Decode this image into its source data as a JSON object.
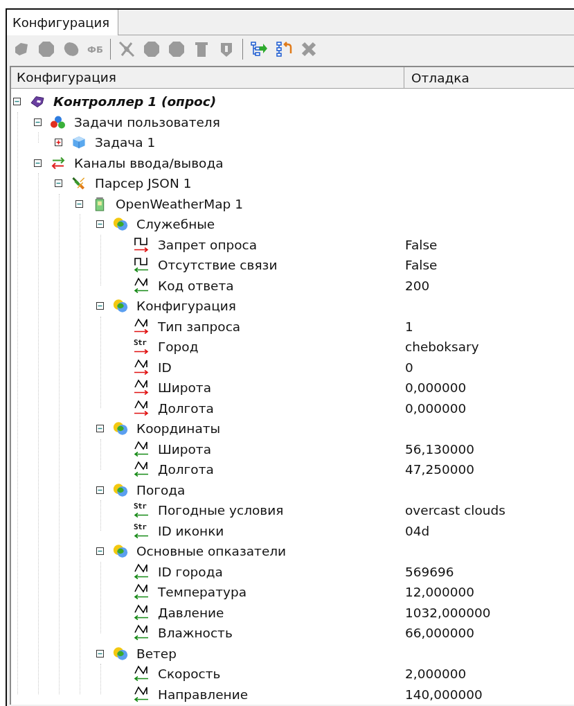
{
  "tabs": [
    {
      "label": "Конфигурация",
      "selected": true
    }
  ],
  "toolbar": [
    {
      "kind": "blob",
      "disabled": true
    },
    {
      "kind": "octagon",
      "disabled": true
    },
    {
      "kind": "ellipse",
      "disabled": true
    },
    {
      "kind": "text",
      "label": "ФБ",
      "disabled": true
    },
    {
      "kind": "separator"
    },
    {
      "kind": "cross-link",
      "disabled": true
    },
    {
      "kind": "octagon",
      "disabled": true
    },
    {
      "kind": "octagon",
      "disabled": true
    },
    {
      "kind": "cylinder",
      "disabled": true
    },
    {
      "kind": "shield",
      "disabled": true
    },
    {
      "kind": "separator"
    },
    {
      "kind": "tree-in",
      "disabled": false
    },
    {
      "kind": "tree-out",
      "disabled": false
    },
    {
      "kind": "delete",
      "disabled": true
    }
  ],
  "table": {
    "columns": [
      "Конфигурация",
      "Отладка"
    ],
    "tree": [
      {
        "kind": "controller",
        "label": "Контроллер 1 (опрос)",
        "expanded": true,
        "children": [
          {
            "kind": "tasks",
            "label": "Задачи пользователя",
            "expanded": true,
            "children": [
              {
                "kind": "task",
                "label": "Задача 1",
                "expanded": false
              }
            ]
          },
          {
            "kind": "channels",
            "label": "Каналы ввода/вывода",
            "expanded": true,
            "children": [
              {
                "kind": "parser",
                "label": "Парсер JSON 1",
                "expanded": true,
                "children": [
                  {
                    "kind": "device",
                    "label": "OpenWeatherMap 1",
                    "expanded": true,
                    "children": [
                      {
                        "kind": "group",
                        "label": "Служебные",
                        "expanded": true,
                        "children": [
                          {
                            "kind": "discrete-out",
                            "label": "Запрет опроса",
                            "value": "False"
                          },
                          {
                            "kind": "discrete-in",
                            "label": "Отсутствие связи",
                            "value": "False"
                          },
                          {
                            "kind": "analog-in",
                            "label": "Код ответа",
                            "value": "200"
                          }
                        ]
                      },
                      {
                        "kind": "group",
                        "label": "Конфигурация",
                        "expanded": true,
                        "children": [
                          {
                            "kind": "analog-out",
                            "label": "Тип запроса",
                            "value": "1"
                          },
                          {
                            "kind": "string-out",
                            "tag": "Str",
                            "label": "Город",
                            "value": "cheboksary"
                          },
                          {
                            "kind": "analog-out",
                            "label": "ID",
                            "value": "0"
                          },
                          {
                            "kind": "analog-out",
                            "label": "Широта",
                            "value": "0,000000"
                          },
                          {
                            "kind": "analog-out",
                            "label": "Долгота",
                            "value": "0,000000"
                          }
                        ]
                      },
                      {
                        "kind": "group",
                        "label": "Координаты",
                        "expanded": true,
                        "children": [
                          {
                            "kind": "analog-in",
                            "label": "Широта",
                            "value": "56,130000"
                          },
                          {
                            "kind": "analog-in",
                            "label": "Долгота",
                            "value": "47,250000"
                          }
                        ]
                      },
                      {
                        "kind": "group",
                        "label": "Погода",
                        "expanded": true,
                        "children": [
                          {
                            "kind": "string-in",
                            "tag": "Str",
                            "label": "Погодные условия",
                            "value": "overcast clouds"
                          },
                          {
                            "kind": "string-in",
                            "tag": "Str",
                            "label": "ID иконки",
                            "value": "04d"
                          }
                        ]
                      },
                      {
                        "kind": "group",
                        "label": "Основные опказатели",
                        "expanded": true,
                        "children": [
                          {
                            "kind": "analog-in",
                            "label": "ID города",
                            "value": "569696"
                          },
                          {
                            "kind": "analog-in",
                            "label": "Температура",
                            "value": "12,000000"
                          },
                          {
                            "kind": "analog-in",
                            "label": "Давление",
                            "value": "1032,000000"
                          },
                          {
                            "kind": "analog-in",
                            "label": "Влажность",
                            "value": "66,000000"
                          }
                        ]
                      },
                      {
                        "kind": "group",
                        "label": "Ветер",
                        "expanded": true,
                        "children": [
                          {
                            "kind": "analog-in",
                            "label": "Скорость",
                            "value": "2,000000"
                          },
                          {
                            "kind": "analog-in",
                            "label": "Направление",
                            "value": "140,000000"
                          }
                        ]
                      }
                    ]
                  }
                ]
              }
            ]
          }
        ]
      }
    ]
  }
}
